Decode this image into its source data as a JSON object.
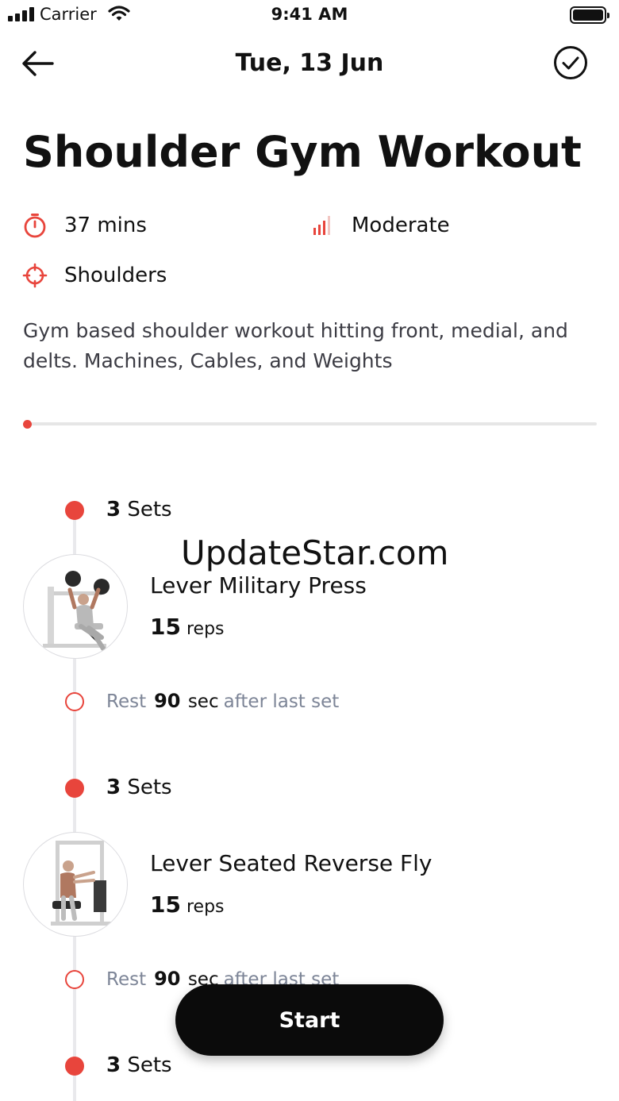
{
  "status_bar": {
    "carrier": "Carrier",
    "time": "9:41 AM"
  },
  "nav": {
    "title": "Tue, 13 Jun",
    "back_icon": "arrow-left-icon",
    "done_icon": "check-circle-icon"
  },
  "workout": {
    "title": "Shoulder Gym Workout",
    "duration": "37 mins",
    "difficulty": "Moderate",
    "target": "Shoulders",
    "description": "Gym based shoulder workout hitting front, medial, and delts. Machines, Cables, and Weights",
    "progress": 0
  },
  "colors": {
    "accent": "#e8453c",
    "muted": "#7d8597",
    "track": "#e9e9ec"
  },
  "exercises": [
    {
      "sets_num": "3",
      "sets_word": "Sets",
      "name": "Lever Military Press",
      "reps_num": "15",
      "reps_word": "reps",
      "rest_label": "Rest",
      "rest_num": "90",
      "rest_unit": "sec",
      "rest_suffix": "after last set"
    },
    {
      "sets_num": "3",
      "sets_word": "Sets",
      "name": "Lever Seated Reverse Fly",
      "reps_num": "15",
      "reps_word": "reps",
      "rest_label": "Rest",
      "rest_num": "90",
      "rest_unit": "sec",
      "rest_suffix": "after last set"
    },
    {
      "sets_num": "3",
      "sets_word": "Sets"
    }
  ],
  "watermark": "UpdateStar.com",
  "start_button": "Start"
}
